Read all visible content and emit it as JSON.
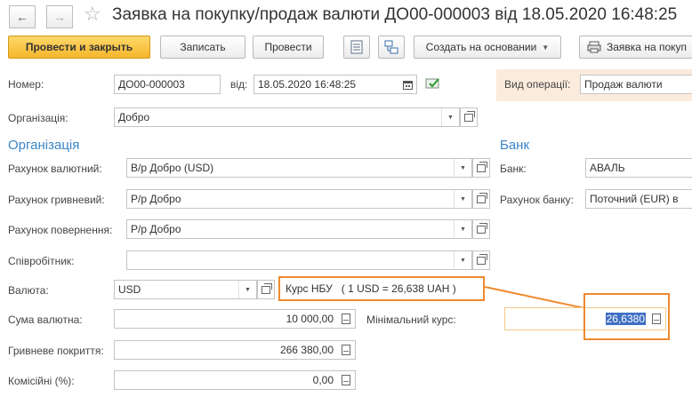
{
  "window": {
    "title": "Заявка на покупку/продаж валюти ДО00-000003 від 18.05.2020 16:48:25",
    "back_icon": "arrow-left-icon",
    "forward_icon": "arrow-right-icon",
    "favorite_icon": "star-icon"
  },
  "toolbar": {
    "post_close": "Провести и закрыть",
    "save": "Записать",
    "post": "Провести",
    "create_based": "Создать на основании",
    "print": "Заявка на покуп"
  },
  "header": {
    "number_label": "Номер:",
    "number_value": "ДО00-000003",
    "date_label": "від:",
    "date_value": "18.05.2020 16:48:25",
    "operation_label": "Вид операції:",
    "operation_value": "Продаж валюти"
  },
  "organization": {
    "label": "Організація:",
    "value": "Добро"
  },
  "org_section": {
    "title": "Організація",
    "fx_account_label": "Рахунок валютний:",
    "fx_account_value": "В/р Добро (USD)",
    "uah_account_label": "Рахунок гривневий:",
    "uah_account_value": "Р/р Добро",
    "return_account_label": "Рахунок повернення:",
    "return_account_value": "Р/р Добро",
    "employee_label": "Співробітник:",
    "employee_value": ""
  },
  "bank_section": {
    "title": "Банк",
    "bank_label": "Банк:",
    "bank_value": "АВАЛЬ",
    "bank_account_label": "Рахунок банку:",
    "bank_account_value": "Поточний (EUR) в"
  },
  "currency": {
    "label": "Валюта:",
    "value": "USD",
    "nbu_rate_text": "Курс НБУ   ( 1 USD = 26,638 UAH )"
  },
  "amounts": {
    "fx_amount_label": "Сума валютна:",
    "fx_amount_value": "10 000,00",
    "min_rate_label": "Мінімальний курс:",
    "min_rate_value": "26,6380",
    "uah_cover_label": "Гривневе покриття:",
    "uah_cover_value": "266 380,00",
    "commission_label": "Комісійні (%):",
    "commission_value": "0,00"
  },
  "colors": {
    "accent_orange": "#ef8a2e",
    "section_blue": "#3b85c8",
    "primary_button": "#f4b62b"
  }
}
